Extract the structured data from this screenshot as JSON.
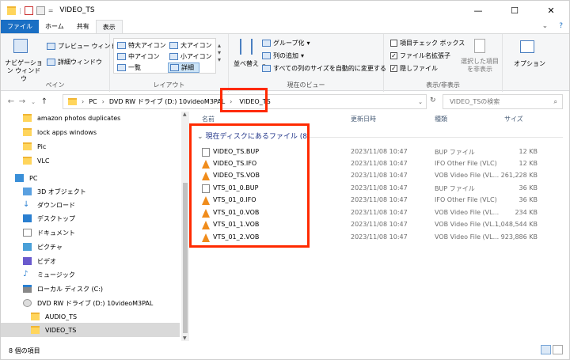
{
  "window": {
    "title": "VIDEO_TS",
    "minimize": "—",
    "maximize": "☐",
    "close": "✕"
  },
  "tabs": [
    "ファイル",
    "ホーム",
    "共有",
    "表示"
  ],
  "ribbon": {
    "pane": {
      "nav_pane": "ナビゲーション ウィンドウ",
      "preview": "プレビュー ウィンドウ",
      "details": "詳細ウィンドウ",
      "label": "ペイン"
    },
    "layout": {
      "items": [
        "特大アイコン",
        "大アイコン",
        "中アイコン",
        "小アイコン",
        "一覧",
        "詳細"
      ],
      "label": "レイアウト"
    },
    "view": {
      "sort": "並べ替え",
      "group": "グループ化",
      "add_column": "列の追加",
      "autosize": "すべての列のサイズを自動的に変更する",
      "label": "現在のビュー"
    },
    "showhide": {
      "checkbox": "項目チェック ボックス",
      "extensions": "ファイル名拡張子",
      "hidden": "隠しファイル",
      "hide_selected": "選択した項目を非表示",
      "label": "表示/非表示"
    },
    "options": "オプション"
  },
  "address": {
    "crumbs": [
      "PC",
      "DVD RW ドライブ (D:) 10videoM3PAL",
      "VIDEO_TS"
    ],
    "search_placeholder": "VIDEO_TSの検索"
  },
  "nav": {
    "items": [
      {
        "label": "amazon photos duplicates",
        "icon": "folder"
      },
      {
        "label": "lock apps windows",
        "icon": "folder"
      },
      {
        "label": "Pic",
        "icon": "folder"
      },
      {
        "label": "VLC",
        "icon": "folder"
      },
      {
        "label": "PC",
        "icon": "pc"
      },
      {
        "label": "3D オブジェクト",
        "icon": "3d"
      },
      {
        "label": "ダウンロード",
        "icon": "download"
      },
      {
        "label": "デスクトップ",
        "icon": "desktop"
      },
      {
        "label": "ドキュメント",
        "icon": "document"
      },
      {
        "label": "ピクチャ",
        "icon": "pictures"
      },
      {
        "label": "ビデオ",
        "icon": "video"
      },
      {
        "label": "ミュージック",
        "icon": "music"
      },
      {
        "label": "ローカル ディスク (C:)",
        "icon": "disk"
      },
      {
        "label": "DVD RW ドライブ (D:) 10videoM3PAL",
        "icon": "dvd"
      },
      {
        "label": "AUDIO_TS",
        "icon": "folder"
      },
      {
        "label": "VIDEO_TS",
        "icon": "folder"
      }
    ]
  },
  "columns": {
    "name": "名前",
    "date": "更新日時",
    "type": "種類",
    "size": "サイズ"
  },
  "group_header": "現在ディスクにあるファイル (8)",
  "files": [
    {
      "name": "VIDEO_TS.BUP",
      "date": "2023/11/08 10:47",
      "type": "BUP ファイル",
      "size": "12 KB",
      "icon": "doc"
    },
    {
      "name": "VIDEO_TS.IFO",
      "date": "2023/11/08 10:47",
      "type": "IFO Other File (VLC)",
      "size": "12 KB",
      "icon": "vlc"
    },
    {
      "name": "VIDEO_TS.VOB",
      "date": "2023/11/08 10:47",
      "type": "VOB Video File (VL...",
      "size": "261,228 KB",
      "icon": "vlc"
    },
    {
      "name": "VTS_01_0.BUP",
      "date": "2023/11/08 10:47",
      "type": "BUP ファイル",
      "size": "36 KB",
      "icon": "doc"
    },
    {
      "name": "VTS_01_0.IFO",
      "date": "2023/11/08 10:47",
      "type": "IFO Other File (VLC)",
      "size": "36 KB",
      "icon": "vlc"
    },
    {
      "name": "VTS_01_0.VOB",
      "date": "2023/11/08 10:47",
      "type": "VOB Video File (VL...",
      "size": "234 KB",
      "icon": "vlc"
    },
    {
      "name": "VTS_01_1.VOB",
      "date": "2023/11/08 10:47",
      "type": "VOB Video File (VL...",
      "size": "1,048,544 KB",
      "icon": "vlc"
    },
    {
      "name": "VTS_01_2.VOB",
      "date": "2023/11/08 10:47",
      "type": "VOB Video File (VL...",
      "size": "923,886 KB",
      "icon": "vlc"
    }
  ],
  "status": "8 個の項目",
  "colors": {
    "accent": "#1a6fc4",
    "highlight_box": "#ff2a00"
  }
}
